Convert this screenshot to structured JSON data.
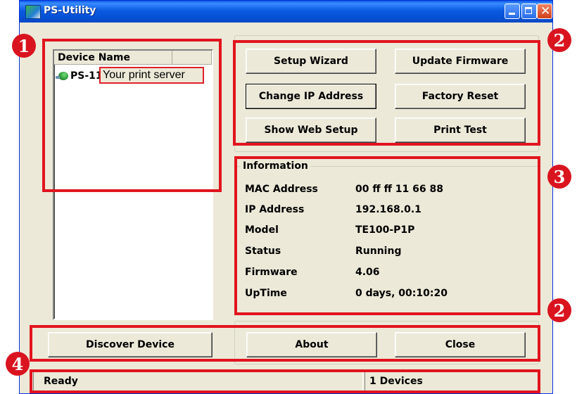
{
  "window": {
    "title": "PS-Utility"
  },
  "device_list": {
    "columns": [
      "Device Name",
      ""
    ],
    "rows": [
      {
        "name": "PS-11"
      }
    ],
    "callout": "Your print server"
  },
  "buttons": {
    "setup_wizard": "Setup Wizard",
    "update_firmware": "Update Firmware",
    "change_ip": "Change IP Address",
    "factory_reset": "Factory Reset",
    "show_web_setup": "Show Web Setup",
    "print_test": "Print Test",
    "discover_device": "Discover Device",
    "about": "About",
    "close": "Close"
  },
  "information": {
    "legend": "Information",
    "rows": [
      {
        "label": "MAC Address",
        "value": "00 ff ff 11 66 88"
      },
      {
        "label": "IP Address",
        "value": "192.168.0.1"
      },
      {
        "label": "Model",
        "value": "TE100-P1P"
      },
      {
        "label": "Status",
        "value": "Running"
      },
      {
        "label": "Firmware",
        "value": "4.06"
      },
      {
        "label": "UpTime",
        "value": "0 days, 00:10:20"
      }
    ]
  },
  "statusbar": {
    "status": "Ready",
    "devices": "1 Devices"
  },
  "annotations": {
    "badges": [
      "1",
      "2",
      "3",
      "2",
      "4"
    ],
    "color": "#e1141e"
  }
}
